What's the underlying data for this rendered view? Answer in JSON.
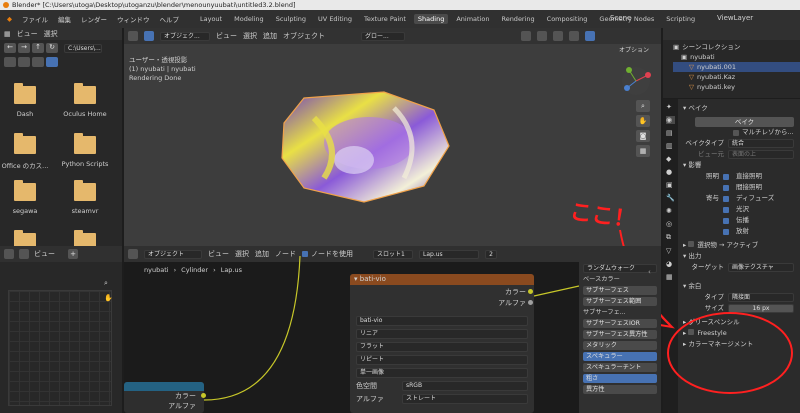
{
  "title_bar": "Blender* [C:\\Users\\utoga\\Desktop\\utoganzu\\blender\\menounyuubati\\untitled3.2.blend]",
  "menu": [
    "ファイル",
    "編集",
    "レンダー",
    "ウィンドウ",
    "ヘルプ"
  ],
  "workspaces": [
    "Layout",
    "Modeling",
    "Sculpting",
    "UV Editing",
    "Texture Paint",
    "Shading",
    "Animation",
    "Rendering",
    "Compositing",
    "Geometry Nodes",
    "Scripting"
  ],
  "active_workspace": "Shading",
  "scene": {
    "label": "Scene",
    "view_layer": "ViewLayer"
  },
  "file_browser": {
    "menu": [
      "ビュー",
      "選択"
    ],
    "path": "C:\\Users\\...",
    "folders": [
      "Dash",
      "Oculus Home",
      "Office のカス...",
      "Python Scripts",
      "segawa",
      "steamvr"
    ]
  },
  "viewport": {
    "header": [
      "オブジェク...",
      "ビュー",
      "選択",
      "追加",
      "オブジェクト",
      "グロー..."
    ],
    "options": "オプション",
    "info1": "ユーザー・透視投影",
    "info2": "(1) nyubati | nyubati",
    "info3": "Rendering Done"
  },
  "outliner": {
    "title": "シーンコレクション",
    "items": [
      "nyubati",
      "nyubati.001",
      "nyubati.Kaz",
      "nyubati.key"
    ]
  },
  "properties": {
    "bake_section": "ベイク",
    "bake_button": "ベイク",
    "multires": "マルチレゾから...",
    "bake_type_label": "ベイクタイプ",
    "bake_type_value": "統合",
    "view_from_label": "ビュー元",
    "view_from_value": "表面の上",
    "influence": "影響",
    "lighting_label": "照明",
    "lighting_items": [
      "直接照明",
      "間接照明"
    ],
    "contrib_label": "寄与",
    "contrib_items": [
      "ディフューズ",
      "光沢",
      "伝播",
      "放射"
    ],
    "selected_active": "選択物 → アクティブ",
    "output": "出力",
    "target_label": "ターゲット",
    "target_value": "画像テクスチャ",
    "margin": "余白",
    "type_label": "タイプ",
    "type_value": "隣接面",
    "size_label": "サイズ",
    "size_value": "16 px",
    "grease_pencil": "グリースペンシル",
    "color_management": "カラーマネージメント",
    "freestyle": "Freestyle"
  },
  "annotation": "ここ！",
  "image_editor": {
    "menu": [
      "ビュー"
    ]
  },
  "node_editor": {
    "header": [
      "オブジェクト",
      "ビュー",
      "選択",
      "追加",
      "ノード"
    ],
    "use_nodes": "ノードを使用",
    "slot": "スロット1",
    "material": "Lap.us",
    "users": "2",
    "breadcrumb": [
      "nyubati",
      "Cylinder",
      "Lap.us"
    ],
    "image_node": {
      "title": "bati-vio",
      "outputs": [
        "カラー",
        "アルファ"
      ],
      "image": "bati-vio",
      "options": [
        "リニア",
        "フラット",
        "リピート",
        "単一画像"
      ],
      "colorspace_label": "色空間",
      "colorspace_value": "sRGB",
      "alpha_label": "アルファ",
      "alpha_value": "ストレート"
    },
    "bsdf_inputs": [
      "ランダムウォーク",
      "ベースカラー",
      "サブサーフェス",
      "サブサーフェス範囲",
      "サブサーフェ...",
      "サブサーフェスIOR",
      "サブサーフェス異方性",
      "メタリック",
      "スペキュラー",
      "スペキュラーチント",
      "粗さ",
      "異方性"
    ],
    "left_node_outputs": [
      "カラー",
      "アルファ"
    ]
  }
}
